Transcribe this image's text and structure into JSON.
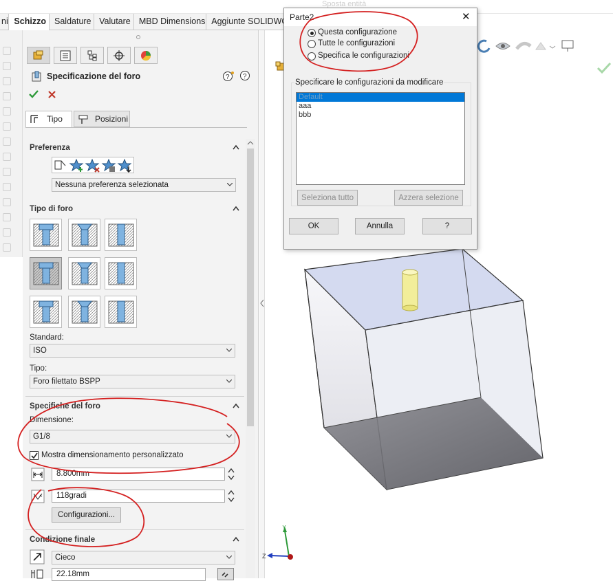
{
  "topstrip": {
    "faded_label": "Sposta entità"
  },
  "tabs": [
    {
      "label": "ni",
      "active": false
    },
    {
      "label": "Schizzo",
      "active": true
    },
    {
      "label": "Saldature",
      "active": false
    },
    {
      "label": "Valutare",
      "active": false
    },
    {
      "label": "MBD Dimensions",
      "active": false
    },
    {
      "label": "Aggiunte SOLIDWO",
      "active": false
    }
  ],
  "feature": {
    "title": "Specificazione del foro",
    "subtabs": [
      {
        "label": "Tipo",
        "active": true
      },
      {
        "label": "Posizioni",
        "active": false
      }
    ]
  },
  "preferenza": {
    "header": "Preferenza",
    "selected": "Nessuna preferenza selezionata"
  },
  "tipo_foro": {
    "header": "Tipo di foro"
  },
  "standard": {
    "label": "Standard:",
    "value": "ISO"
  },
  "tipo": {
    "label": "Tipo:",
    "value": "Foro filettato BSPP"
  },
  "specifiche": {
    "header": "Specifiche del foro",
    "dimensione_label": "Dimensione:",
    "dimensione_value": "G1/8",
    "checkbox_label": "Mostra dimensionamento personalizzato",
    "checkbox_checked": true,
    "diameter_value": "8.800mm",
    "angle_value": "118gradi",
    "config_button": "Configurazioni..."
  },
  "condizione": {
    "header": "Condizione finale",
    "value": "Cieco",
    "depth_value": "22.18mm"
  },
  "dialog": {
    "title": "Parte2",
    "close": "✕",
    "radios": [
      {
        "label": "Questa configurazione",
        "checked": true
      },
      {
        "label": "Tutte le configurazioni",
        "checked": false
      },
      {
        "label": "Specifica le configurazioni",
        "checked": false
      }
    ],
    "list_label": "Specificare le configurazioni da modificare",
    "configs": [
      {
        "name": "Default",
        "selected": true
      },
      {
        "name": "aaa",
        "selected": false
      },
      {
        "name": "bbb",
        "selected": false
      }
    ],
    "select_all": "Seleziona tutto",
    "clear_selection": "Azzera selezione",
    "ok": "OK",
    "cancel": "Annulla",
    "help": "?"
  },
  "triad": {
    "x_label": "Y",
    "z_label": "Z"
  },
  "colors": {
    "annotation_red": "#d42020",
    "cylinder_yellow": "#f2ee9a",
    "box_top": "#d4daf0",
    "box_bottom": "#6f6f74",
    "accept_green": "#2e9a3a",
    "cancel_red": "#c0392b"
  },
  "icons": [
    "hole-wizard-icon",
    "help-icon",
    "ok-icon",
    "cancel-icon",
    "property-manager-icon",
    "configuration-manager-icon",
    "dimxpert-icon",
    "display-manager-icon"
  ]
}
